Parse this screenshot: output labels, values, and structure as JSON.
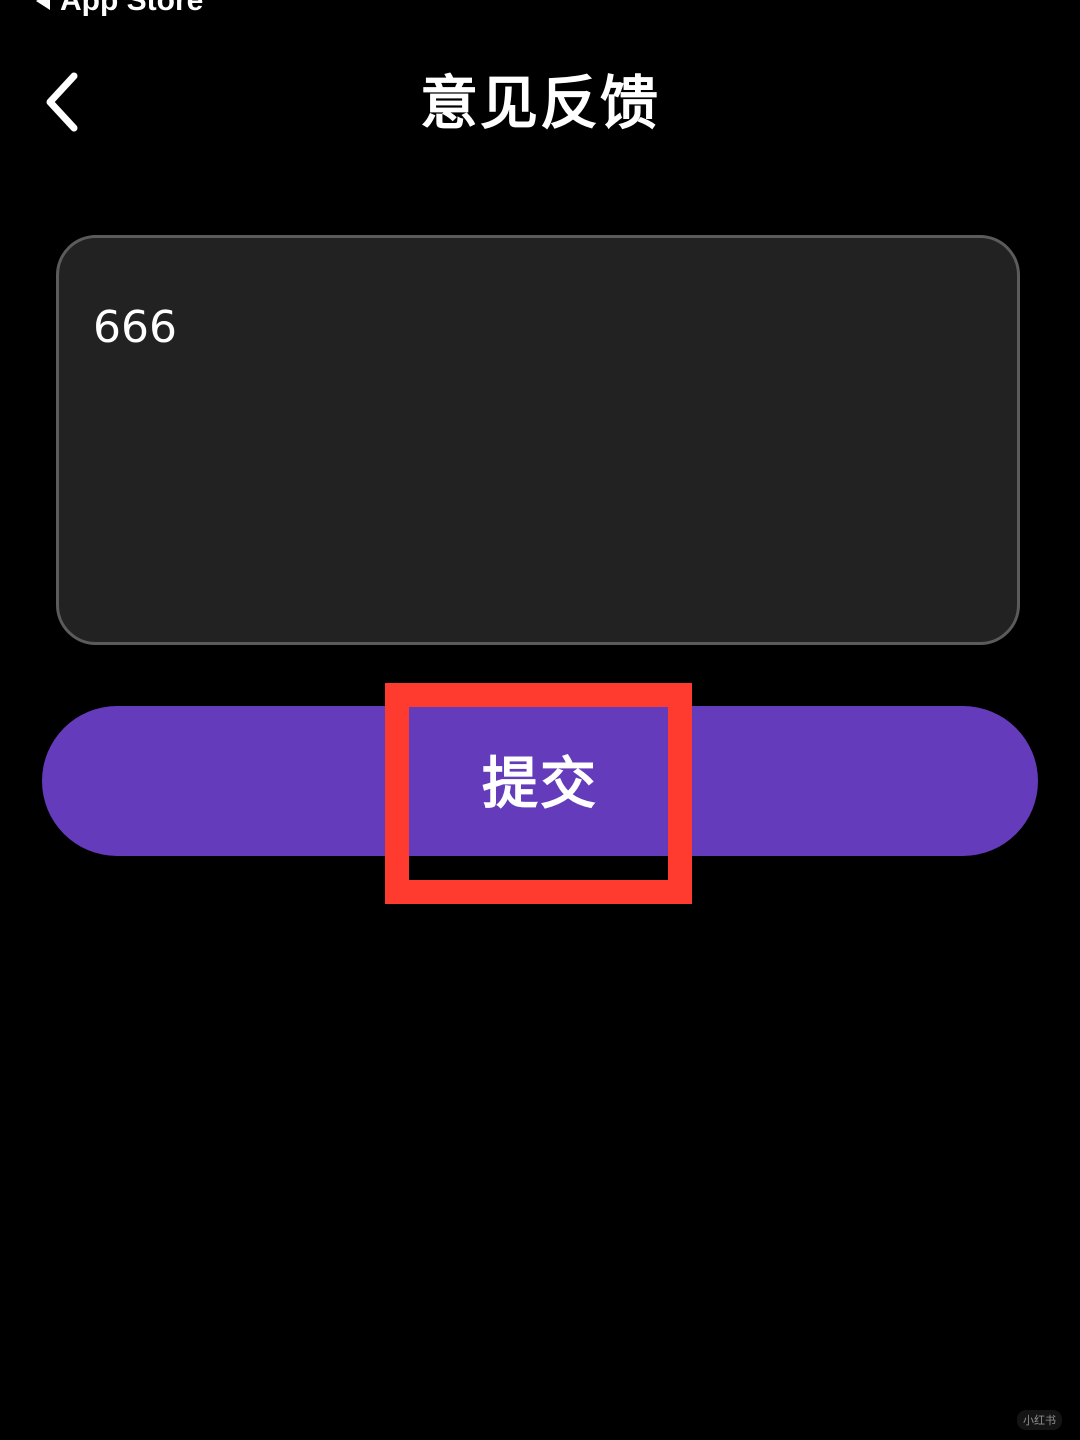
{
  "status_bar": {
    "back_app_label": "App Store"
  },
  "header": {
    "title": "意见反馈",
    "back_icon": "chevron-left-icon"
  },
  "feedback": {
    "value": "666"
  },
  "submit": {
    "label": "提交"
  },
  "annotation": {
    "color": "#ff3b30"
  },
  "colors": {
    "background": "#000000",
    "input_background": "#222222",
    "input_border": "#5b5b5b",
    "accent": "#643cbb"
  },
  "watermark": {
    "text": "小红书"
  }
}
